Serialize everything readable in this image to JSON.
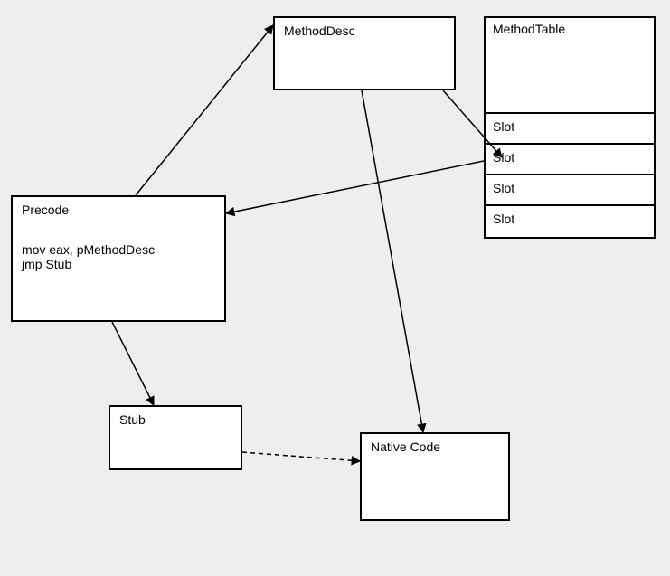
{
  "boxes": {
    "methoddesc": {
      "title": "MethodDesc"
    },
    "methodtable": {
      "title": "MethodTable",
      "slots": [
        "Slot",
        "Slot",
        "Slot",
        "Slot"
      ]
    },
    "precode": {
      "title": "Precode",
      "line1": "mov eax, pMethodDesc",
      "line2": "jmp Stub"
    },
    "stub": {
      "title": "Stub"
    },
    "native": {
      "title": "Native Code"
    }
  }
}
